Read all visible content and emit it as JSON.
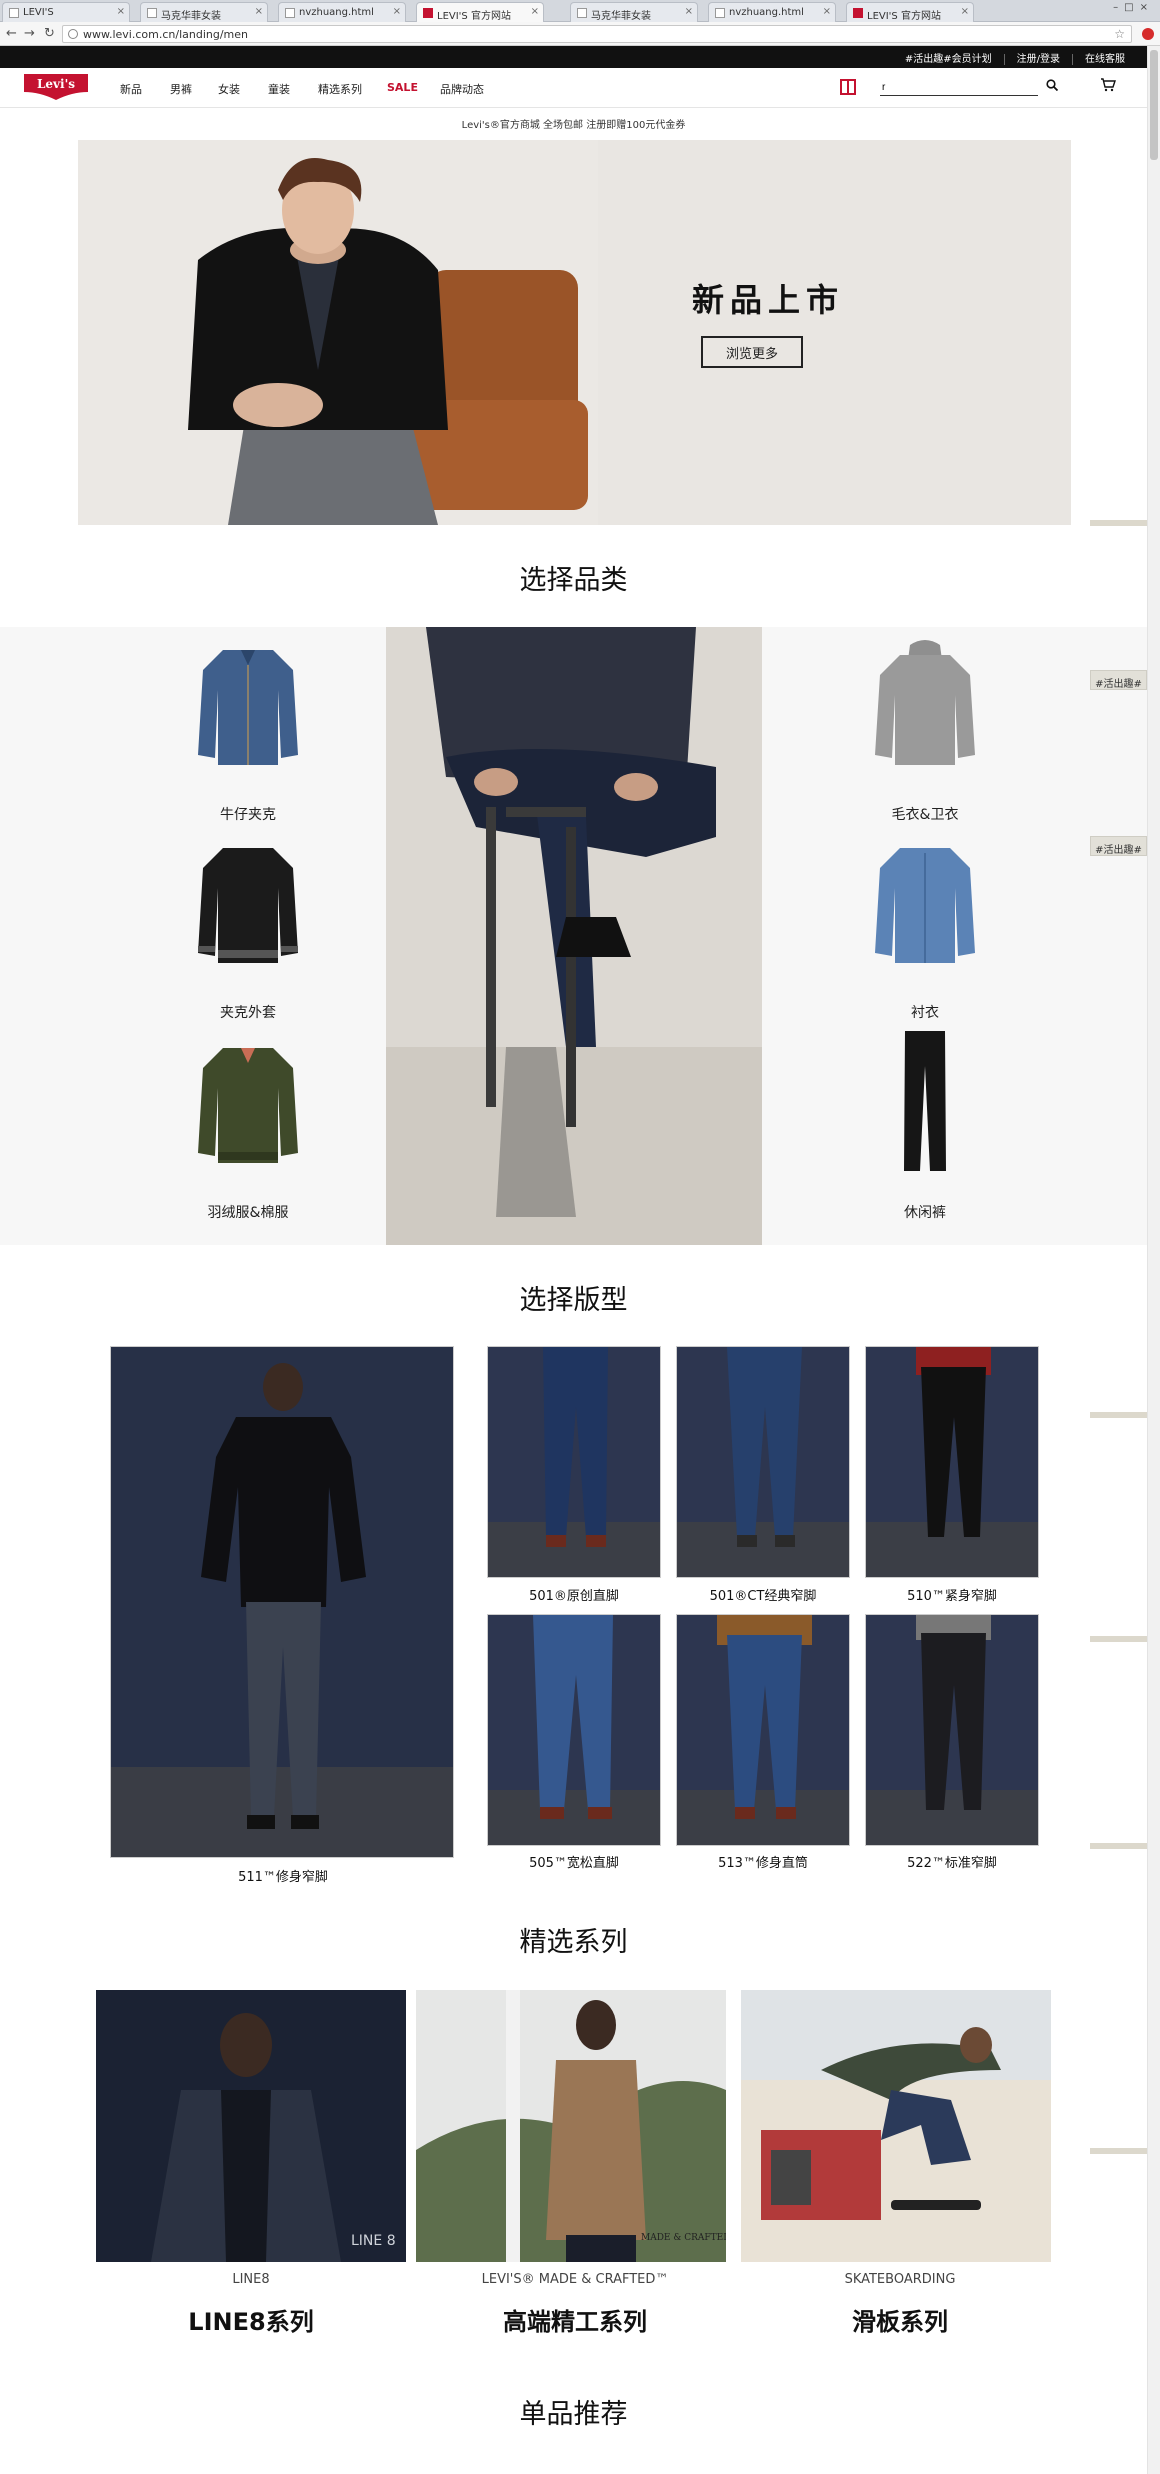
{
  "browser": {
    "tabs": [
      {
        "label": "LEVI'S",
        "active": false
      },
      {
        "label": "马克华菲女装",
        "active": false
      },
      {
        "label": "nvzhuang.html",
        "active": false
      },
      {
        "label": "LEVI'S 官方网站",
        "active": true
      },
      {
        "label": "马克华菲女装",
        "active": false
      },
      {
        "label": "nvzhuang.html",
        "active": false
      },
      {
        "label": "LEVI'S 官方网站",
        "active": false
      }
    ],
    "url": "www.levi.com.cn/landing/men"
  },
  "header": {
    "util_links": [
      "#活出趣#会员计划",
      "注册/登录",
      "在线客服"
    ],
    "logo_text": "Levi's",
    "nav": [
      "新品",
      "男裤",
      "女装",
      "童装",
      "精选系列",
      "SALE",
      "品牌动态"
    ],
    "search_value": "r"
  },
  "promo": "Levi's®官方商城 全场包邮 注册即赠100元代金券",
  "hero": {
    "title": "新品上市",
    "button": "浏览更多"
  },
  "categories": {
    "title": "选择品类",
    "left": [
      "牛仔夹克",
      "夹克外套",
      "羽绒服&棉服"
    ],
    "right": [
      "毛衣&卫衣",
      "衬衣",
      "休闲裤"
    ]
  },
  "fits": {
    "title": "选择版型",
    "big_label": "511™修身窄脚",
    "tiles": [
      "501®原创直脚",
      "501®CT经典窄脚",
      "510™紧身窄脚",
      "505™宽松直脚",
      "513™修身直筒",
      "522™标准窄脚"
    ]
  },
  "collections": {
    "title": "精选系列",
    "items": [
      {
        "sub": "LINE8",
        "title": "LINE8系列",
        "badge": "LINE 8"
      },
      {
        "sub": "LEVI'S® MADE & CRAFTED™",
        "title": "高端精工系列",
        "badge": "MADE & CRAFTED"
      },
      {
        "sub": "SKATEBOARDING",
        "title": "滑板系列",
        "badge": ""
      }
    ]
  },
  "recommend": {
    "title": "单品推荐"
  },
  "side_tabs": [
    "#活出趣#",
    "#活出趣#"
  ],
  "colors": {
    "brand_red": "#c41230",
    "util_bar": "#111111",
    "hero_bg": "#e9e6e2"
  }
}
